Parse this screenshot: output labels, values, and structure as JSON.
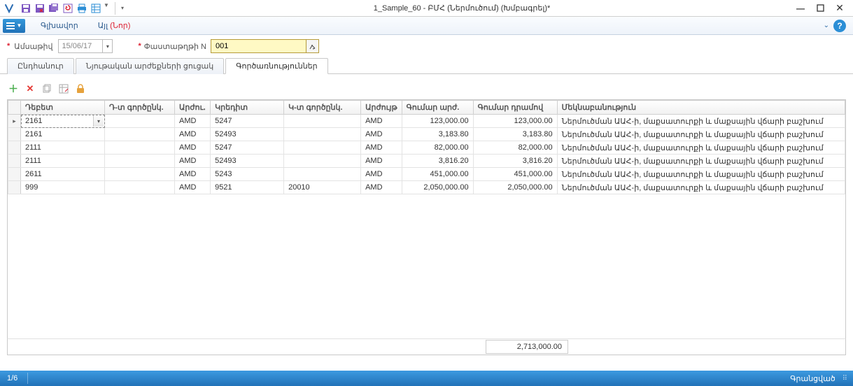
{
  "window": {
    "title": "1_Sample_60 - ԲՄՀ (Ներմուծում) (Խմբագրել)*",
    "minimize": "—",
    "maximize": "□",
    "close": "✕"
  },
  "menubar": {
    "main": "Գլխավոր",
    "other_prefix": "Այլ ",
    "other_new": "(Նոր)"
  },
  "form": {
    "date_label": "Ամսաթիվ",
    "date_value": "15/06/17",
    "doc_label": "Փաստաթղթի N",
    "doc_value": "001"
  },
  "tabs": [
    "Ընդհանուր",
    "Նյութական արժեքների ցուցակ",
    "Գործառնություններ"
  ],
  "grid": {
    "headers": {
      "debit": "Դեբետ",
      "dpart": "Դ-տ գործընկ.",
      "cur1": "Արժու․",
      "credit": "Կրեդիտ",
      "kpart": "Կ-տ գործընկ.",
      "cur2": "Արժույթ",
      "amt1": "Գումար արժ.",
      "amt2": "Գումար դրամով",
      "comment": "Մեկնաբանություն"
    },
    "rows": [
      {
        "debit": "2161",
        "dpart": "",
        "cur1": "AMD",
        "credit": "5247",
        "kpart": "",
        "cur2": "AMD",
        "amt1": "123,000.00",
        "amt2": "123,000.00",
        "comment": "Ներմուծման ԱԱՀ-ի, մաքսատուրքի և մաքսային վճարի բաշխում"
      },
      {
        "debit": "2161",
        "dpart": "",
        "cur1": "AMD",
        "credit": "52493",
        "kpart": "",
        "cur2": "AMD",
        "amt1": "3,183.80",
        "amt2": "3,183.80",
        "comment": "Ներմուծման ԱԱՀ-ի, մաքսատուրքի և մաքսային վճարի բաշխում"
      },
      {
        "debit": "2111",
        "dpart": "",
        "cur1": "AMD",
        "credit": "5247",
        "kpart": "",
        "cur2": "AMD",
        "amt1": "82,000.00",
        "amt2": "82,000.00",
        "comment": "Ներմուծման ԱԱՀ-ի, մաքսատուրքի և մաքսային վճարի բաշխում"
      },
      {
        "debit": "2111",
        "dpart": "",
        "cur1": "AMD",
        "credit": "52493",
        "kpart": "",
        "cur2": "AMD",
        "amt1": "3,816.20",
        "amt2": "3,816.20",
        "comment": "Ներմուծման ԱԱՀ-ի, մաքսատուրքի և մաքսային վճարի բաշխում"
      },
      {
        "debit": "2611",
        "dpart": "",
        "cur1": "AMD",
        "credit": "5243",
        "kpart": "",
        "cur2": "AMD",
        "amt1": "451,000.00",
        "amt2": "451,000.00",
        "comment": "Ներմուծման ԱԱՀ-ի, մաքսատուրքի և մաքսային վճարի բաշխում"
      },
      {
        "debit": "999",
        "dpart": "",
        "cur1": "AMD",
        "credit": "9521",
        "kpart": "20010",
        "cur2": "AMD",
        "amt1": "2,050,000.00",
        "amt2": "2,050,000.00",
        "comment": "Ներմուծման ԱԱՀ-ի, մաքսատուրքի և մաքսային վճարի բաշխում"
      }
    ],
    "total": "2,713,000.00"
  },
  "statusbar": {
    "position": "1/6",
    "status": "Գրանցված"
  }
}
